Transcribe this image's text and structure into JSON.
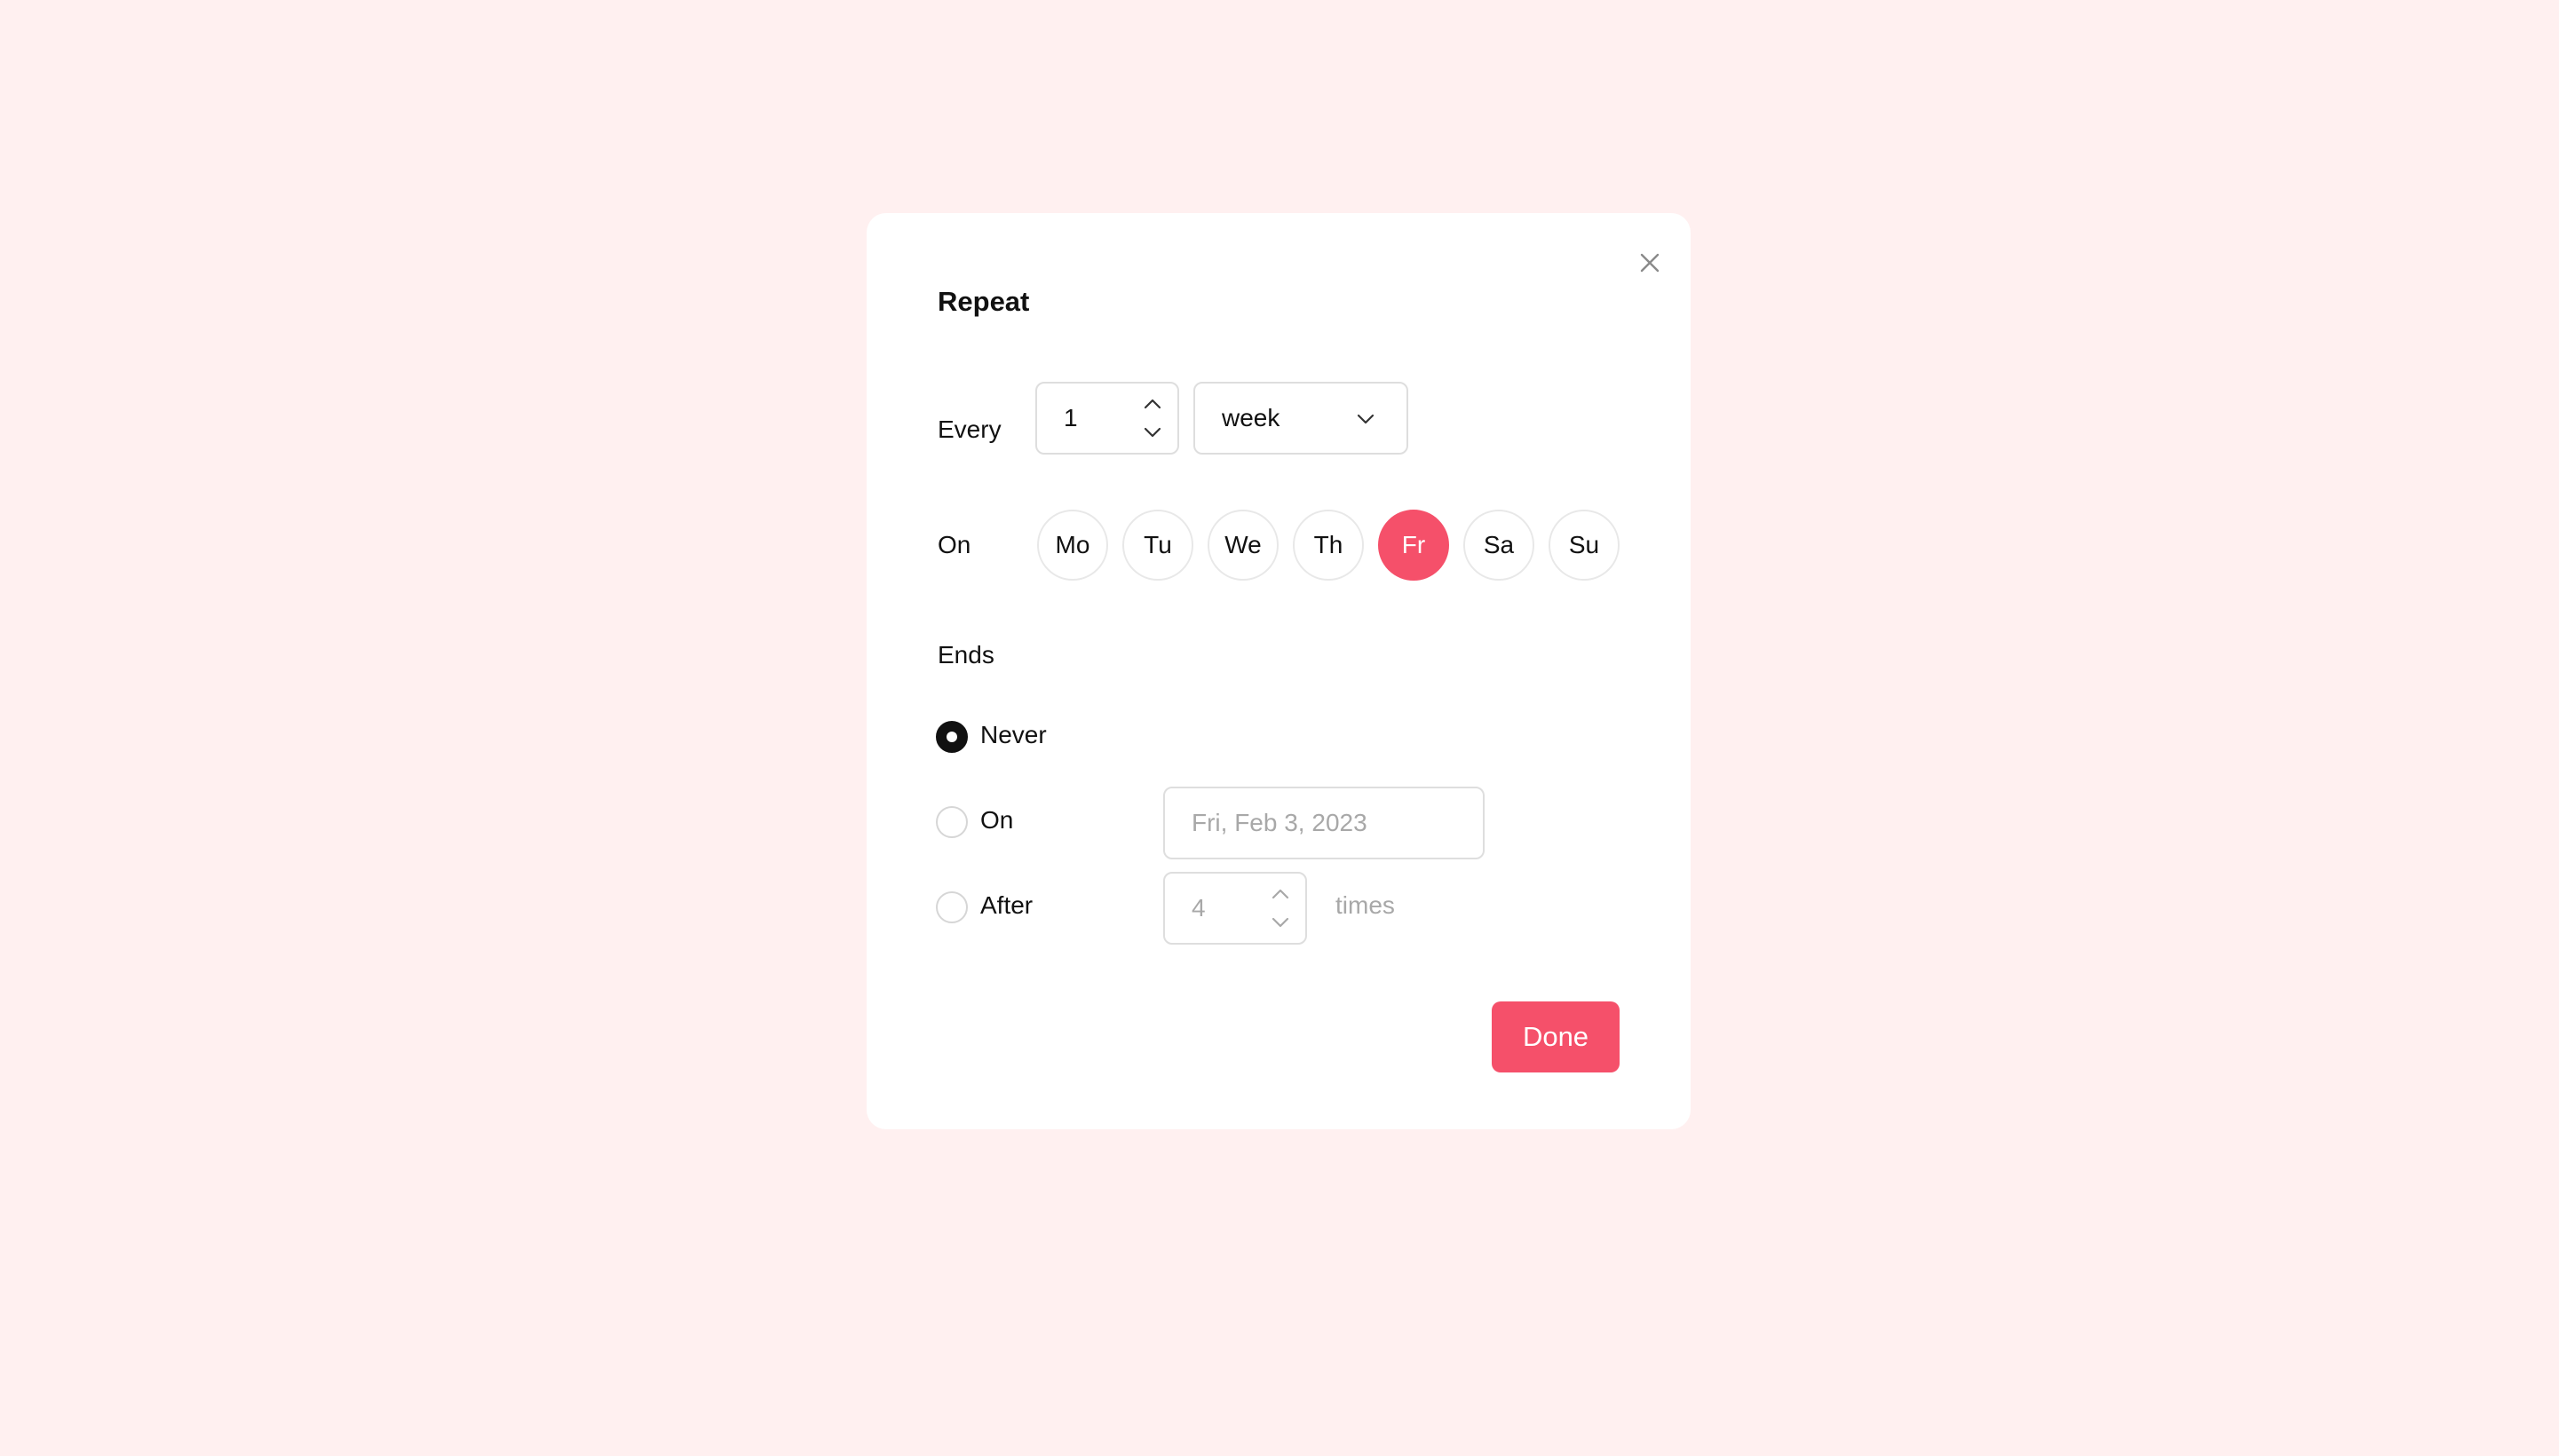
{
  "colors": {
    "background": "#fff0f0",
    "accent": "#f5506a",
    "dialog": "#ffffff"
  },
  "dialog": {
    "title": "Repeat",
    "close_icon": "close-icon"
  },
  "every": {
    "label": "Every",
    "interval_value": "1",
    "unit_value": "week"
  },
  "on_days": {
    "label": "On",
    "days": [
      {
        "label": "Mo",
        "selected": false
      },
      {
        "label": "Tu",
        "selected": false
      },
      {
        "label": "We",
        "selected": false
      },
      {
        "label": "Th",
        "selected": false
      },
      {
        "label": "Fr",
        "selected": true
      },
      {
        "label": "Sa",
        "selected": false
      },
      {
        "label": "Su",
        "selected": false
      }
    ]
  },
  "ends": {
    "label": "Ends",
    "options": [
      {
        "label": "Never",
        "checked": true
      },
      {
        "label": "On",
        "checked": false,
        "date_placeholder": "Fri, Feb 3, 2023"
      },
      {
        "label": "After",
        "checked": false,
        "count_value": "4",
        "suffix": "times"
      }
    ]
  },
  "footer": {
    "done_label": "Done"
  }
}
